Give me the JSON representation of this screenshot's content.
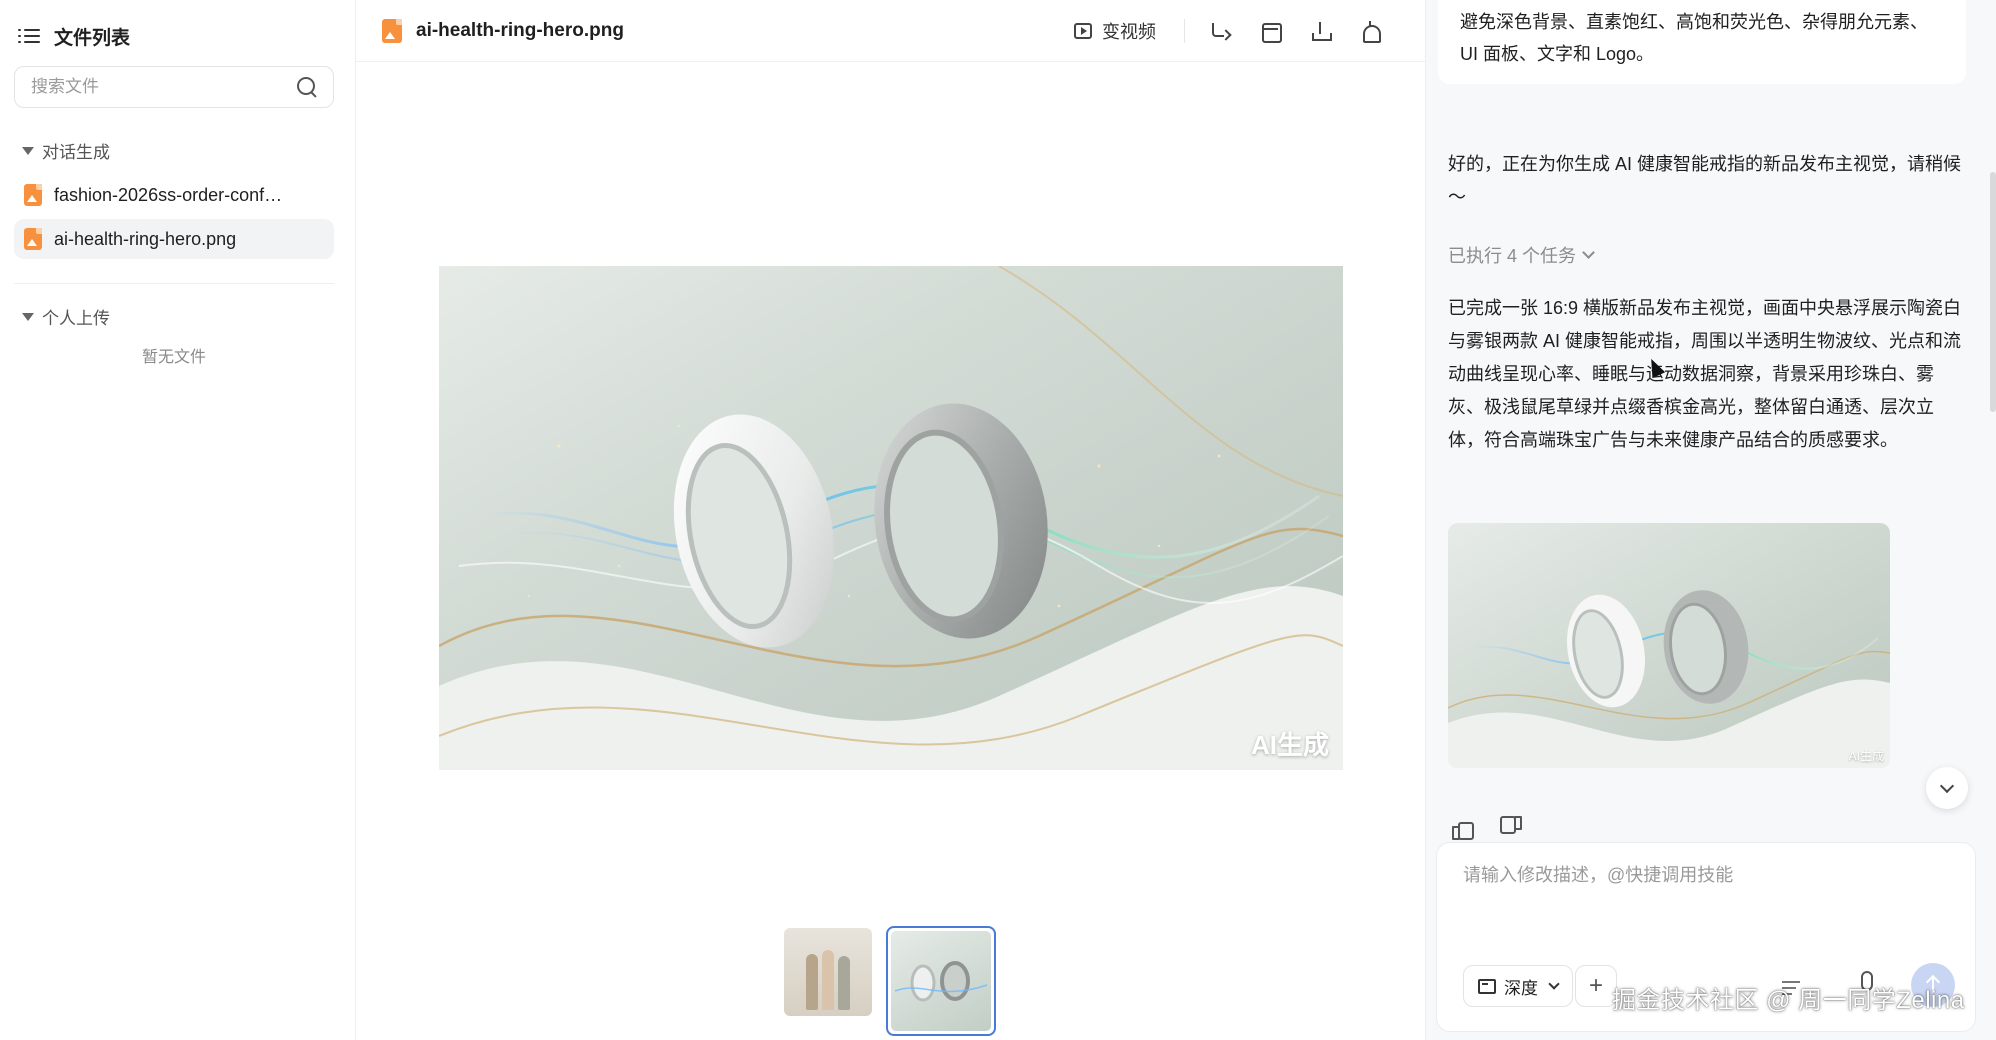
{
  "sidebar": {
    "title": "文件列表",
    "search_placeholder": "搜索文件",
    "groups": [
      {
        "label": "对话生成",
        "files": [
          {
            "name": "fashion-2026ss-order-conf…"
          },
          {
            "name": "ai-health-ring-hero.png"
          }
        ]
      },
      {
        "label": "个人上传",
        "empty": "暂无文件"
      }
    ]
  },
  "preview": {
    "file_name": "ai-health-ring-hero.png",
    "video_label": "变视频",
    "ai_label": "AI生成"
  },
  "chat": {
    "prev_text": "避免深色背景、直素饱红、高饱和荧光色、杂得朋允元素、UI 面板、文字和 Logo。",
    "reply_intro": "好的，正在为你生成 AI 健康智能戒指的新品发布主视觉，请稍候～",
    "tasks_label": "已执行 4 个任务",
    "result_text": "已完成一张 16:9 横版新品发布主视觉，画面中央悬浮展示陶瓷白与雾银两款 AI 健康智能戒指，周围以半透明生物波纹、光点和流动曲线呈现心率、睡眠与运动数据洞察，背景采用珍珠白、雾灰、极浅鼠尾草绿并点缀香槟金高光，整体留白通透、层次立体，符合高端珠宝广告与未来健康产品结合的质感要求。",
    "thumb_ai_label": "AI生成",
    "input_placeholder": "请输入修改描述，@快捷调用技能",
    "mode_label": "深度"
  },
  "watermark": "掘金技术社区 @ 周一同学Zelina",
  "colors": {
    "file_icon": "#f7913d",
    "accent_blue": "#4a7ad8",
    "send_button": "#c9d6f3",
    "panel_bg": "#f7f8fa"
  }
}
